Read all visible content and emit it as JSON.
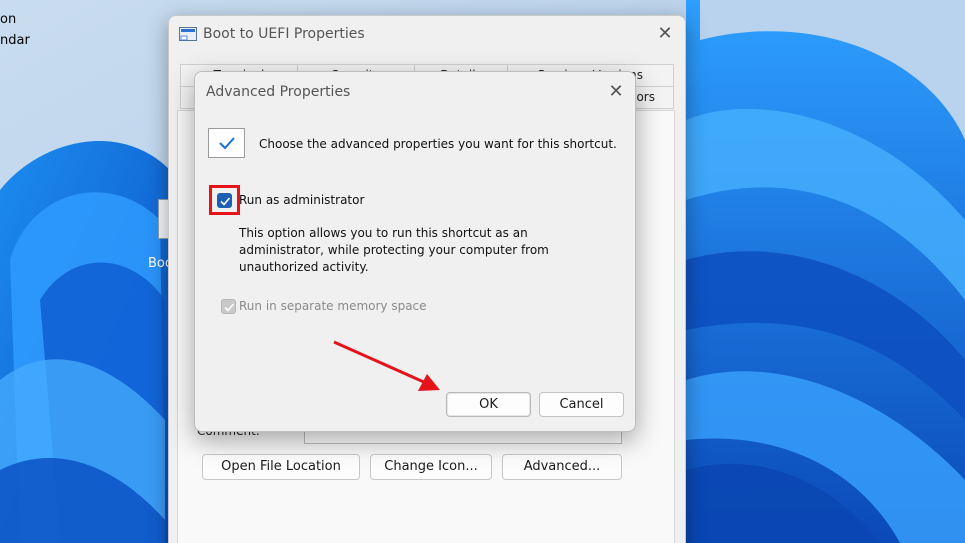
{
  "desktop": {
    "partial_labels": [
      "on",
      "ndar"
    ],
    "shortcut_label": "Boo"
  },
  "properties_window": {
    "title": "Boot to UEFI Properties",
    "close_glyph": "✕",
    "tabs_row_back": [
      "Terminal",
      "Security",
      "Details",
      "Previous Versions"
    ],
    "tabs_row_front_visible_suffix": "ors",
    "comment_label": "Comment:",
    "comment_value": "",
    "buttons": {
      "open_file_location": "Open File Location",
      "change_icon": "Change Icon...",
      "advanced": "Advanced..."
    }
  },
  "advanced_dialog": {
    "title": "Advanced Properties",
    "close_glyph": "✕",
    "prompt": "Choose the advanced properties you want for this shortcut.",
    "run_as_admin": {
      "label": "Run as administrator",
      "checked": true,
      "description_lines": [
        "This option allows you to run this shortcut as an",
        "administrator, while protecting your computer from",
        "unauthorized activity."
      ]
    },
    "separate_memory": {
      "label": "Run in separate memory space",
      "checked": true,
      "disabled": true
    },
    "ok_label": "OK",
    "cancel_label": "Cancel"
  },
  "colors": {
    "accent": "#1d5fb4",
    "highlight": "#e5141b"
  },
  "icons": [
    "app-shortcut-icon",
    "close-icon",
    "checkmark-icon",
    "check-icon",
    "arrow-icon"
  ]
}
